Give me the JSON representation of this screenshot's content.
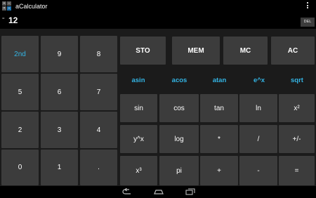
{
  "app": {
    "title": "aCalculator"
  },
  "display": {
    "indicator": "=",
    "value": "12",
    "del_label": "DEL"
  },
  "numpad": {
    "second": "2nd",
    "k9": "9",
    "k8": "8",
    "k5": "5",
    "k6": "6",
    "k7": "7",
    "k2": "2",
    "k3": "3",
    "k4": "4",
    "k0": "0",
    "k1": "1",
    "dot": "."
  },
  "memory": {
    "sto": "STO",
    "mem": "MEM",
    "mc": "MC",
    "ac": "AC"
  },
  "second_labels": {
    "asin": "asin",
    "acos": "acos",
    "atan": "atan",
    "exp": "e^x",
    "sqrt": "sqrt"
  },
  "functions": {
    "sin": "sin",
    "cos": "cos",
    "tan": "tan",
    "ln": "ln",
    "square": "x²",
    "power": "y^x",
    "log": "log",
    "multiply": "*",
    "divide": "/",
    "negate": "+/-",
    "cube": "x³",
    "pi": "pi",
    "plus": "+",
    "minus": "-",
    "equals": "="
  },
  "colors": {
    "accent": "#33b5e5",
    "key": "#3c3c3c",
    "background": "#1b1b1b"
  },
  "icons": {
    "app": "calculator-app-icon",
    "overflow": "overflow-menu-icon",
    "back": "back-icon",
    "home": "home-icon",
    "recents": "recents-icon"
  }
}
